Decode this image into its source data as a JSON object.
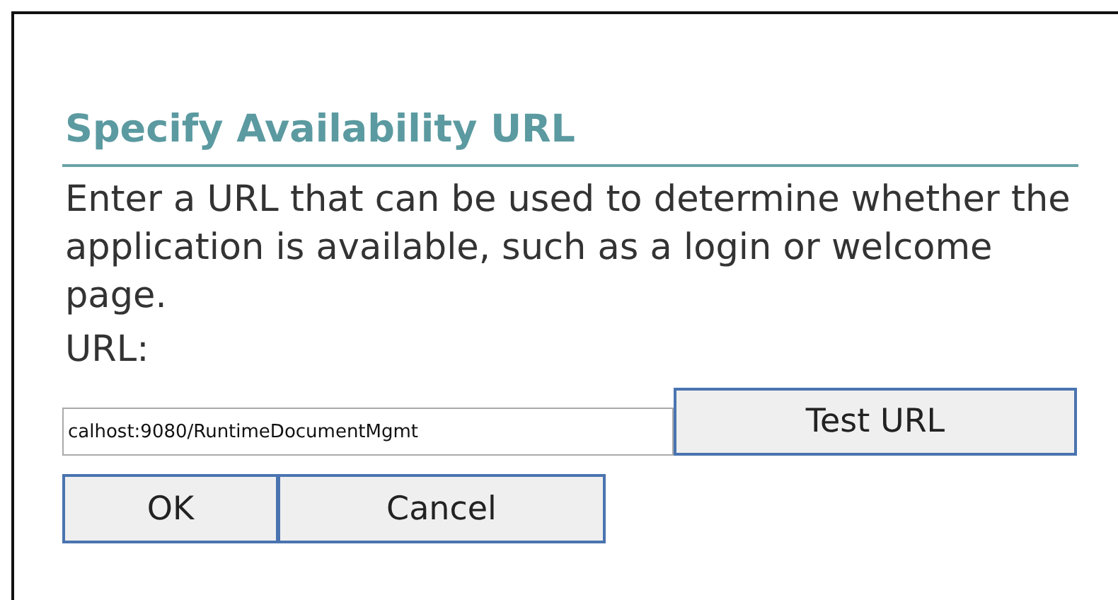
{
  "dialog": {
    "title": "Specify Availability URL",
    "description": "Enter a URL that can be used to determine whether the application is available, such as a login or welcome page.",
    "url_label": "URL:",
    "url_value": "calhost:9080/RuntimeDocumentMgmt",
    "test_button": "Test URL",
    "buttons": [
      "OK",
      "Cancel"
    ]
  }
}
